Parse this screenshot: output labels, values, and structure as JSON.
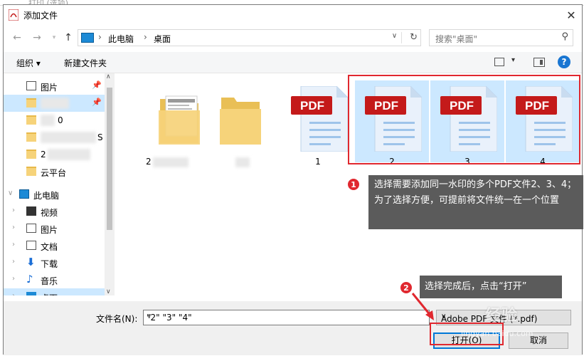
{
  "window": {
    "title": "添加文件"
  },
  "nav": {
    "back": "←",
    "forward": "→",
    "up": "↑",
    "breadcrumb": [
      "此电脑",
      "桌面"
    ],
    "search_placeholder": "搜索\"桌面\""
  },
  "toolbar": {
    "organize": "组织 ▾",
    "new_folder": "新建文件夹",
    "help": "?"
  },
  "sidebar": {
    "items": [
      {
        "label": "图片",
        "type": "quick"
      },
      {
        "label": "",
        "type": "quick-blur"
      },
      {
        "label": "0",
        "type": "folder"
      },
      {
        "label": "S",
        "type": "folder"
      },
      {
        "label": "2",
        "type": "folder"
      },
      {
        "label": "云平台",
        "type": "folder"
      },
      {
        "label": "此电脑",
        "type": "pc"
      },
      {
        "label": "视频",
        "type": "video"
      },
      {
        "label": "图片",
        "type": "pictures"
      },
      {
        "label": "文档",
        "type": "docs"
      },
      {
        "label": "下载",
        "type": "download"
      },
      {
        "label": "音乐",
        "type": "music"
      },
      {
        "label": "桌面",
        "type": "desktop"
      }
    ]
  },
  "files": [
    {
      "name": "2",
      "kind": "folder-doc",
      "selected": false
    },
    {
      "name": "",
      "kind": "folder",
      "selected": false
    },
    {
      "name": "1",
      "kind": "pdf",
      "selected": false
    },
    {
      "name": "2",
      "kind": "pdf",
      "selected": true
    },
    {
      "name": "3",
      "kind": "pdf",
      "selected": true
    },
    {
      "name": "4",
      "kind": "pdf",
      "selected": true
    }
  ],
  "pdf_badge": "PDF",
  "annotations": {
    "badge1": "1",
    "callout1": "选择需要添加同一水印的多个PDF文件2、3、4；为了选择方便，可提前将文件统一在一个位置",
    "badge2": "2",
    "callout2": "选择完成后，点击“打开”"
  },
  "bottom": {
    "filename_label": "文件名(N):",
    "filename_value": "\"2\" \"3\" \"4\"",
    "filetype": "Adobe PDF 文件 (*.pdf)",
    "open_button": "打开(O)",
    "cancel_button": "取消"
  },
  "watermark": {
    "text": "经验",
    "url": "jingyan.baidu.com"
  },
  "colors": {
    "accent_red": "#e0282f",
    "selection": "#cce8ff",
    "pdf_red": "#c41a1a",
    "callout_bg": "#5b5b5b"
  }
}
